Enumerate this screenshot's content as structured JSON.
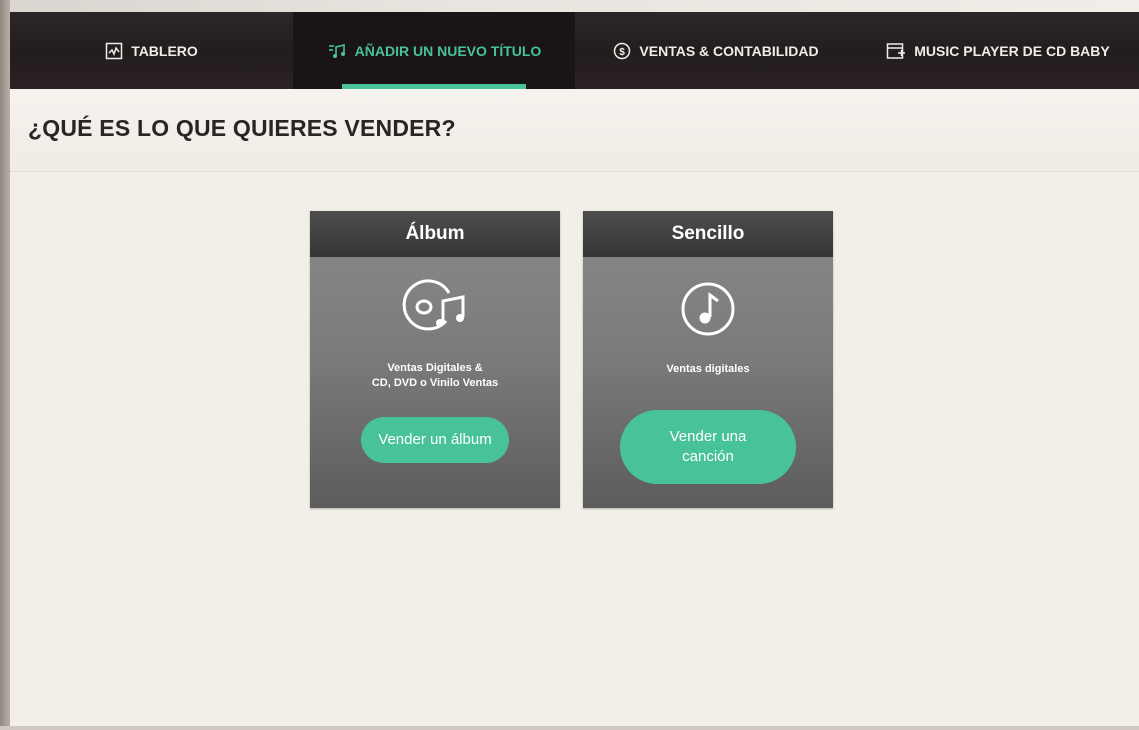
{
  "nav": {
    "items": [
      {
        "label": "TABLERO",
        "icon": "chart-icon"
      },
      {
        "label": "AÑADIR UN NUEVO TÍTULO",
        "icon": "music-list-icon"
      },
      {
        "label": "VENTAS & CONTABILIDAD",
        "icon": "dollar-circle-icon"
      },
      {
        "label": "MUSIC PLAYER DE CD BABY",
        "icon": "player-icon"
      }
    ],
    "active_index": 1
  },
  "page": {
    "title": "¿QUÉ ES LO QUE QUIERES VENDER?"
  },
  "cards": [
    {
      "title": "Álbum",
      "icon": "disc-music-icon",
      "desc_line1": "Ventas Digitales &",
      "desc_line2": "CD, DVD o Vinilo Ventas",
      "button": "Vender un álbum"
    },
    {
      "title": "Sencillo",
      "icon": "music-note-circle-icon",
      "desc_line1": "Ventas digitales",
      "button_line1": "Vender una",
      "button_line2": "canción"
    }
  ],
  "colors": {
    "accent": "#46c39c",
    "nav_bg": "#231c1f",
    "card_head": "#3a3a3a",
    "page_bg": "#f2efe9"
  }
}
